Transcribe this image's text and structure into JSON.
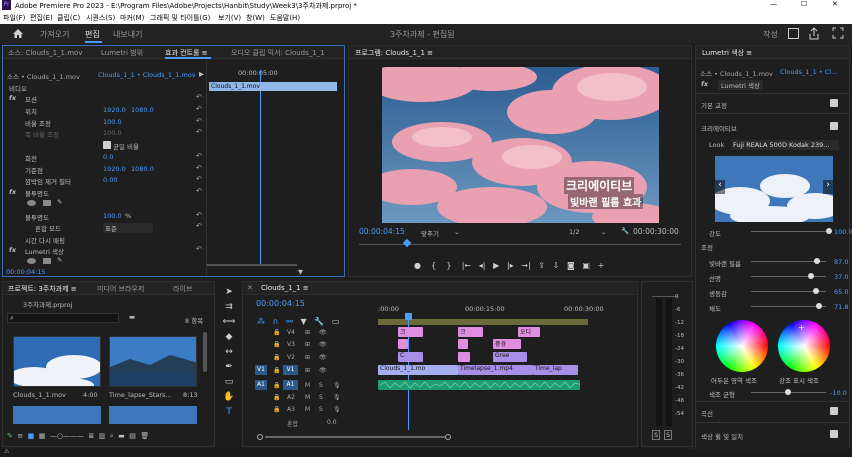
{
  "window": {
    "title": "Adobe Premiere Pro 2023 - E:\\Program Files\\Adobe\\Projects\\Hanbit\\Study\\Week3\\3주차과제.prproj *"
  },
  "menu": [
    "파일(F)",
    "편집(E)",
    "클립(C)",
    "시퀀스(S)",
    "마커(M)",
    "그래픽 및 타이틀(G)",
    "보기(V)",
    "창(W)",
    "도움말(H)"
  ],
  "workspace": {
    "tabs": [
      "가져오기",
      "편집",
      "내보내기"
    ],
    "active_tab": "편집",
    "doc_title": "3주차과제 - 편집됨",
    "right_label": "작성"
  },
  "effect_controls": {
    "tabs": [
      "소스: Clouds_1_1.mov",
      "Lumetri 범위",
      "효과 컨트롤 ≡",
      "오디오 클립 믹서: Clouds_1_1"
    ],
    "source_line": "소스 • Clouds_1_1.mov",
    "seq_line": "Clouds_1_1 • Clouds_1_1.mov",
    "time_label": "00:00:05:00",
    "clip_label": "Clouds_1_1.mov",
    "section_video": "비디오",
    "fx_motion": "모션",
    "position_label": "위치",
    "position_x": "1920.0",
    "position_y": "1080.0",
    "scale_label": "비율 조정",
    "scale_val": "100.0",
    "scale_width_label": "폭 비율 조정",
    "scale_width_val": "100.0",
    "uniform_scale": "균일 비율",
    "rotation_label": "회전",
    "rotation_val": "0.0",
    "anchor_label": "기준점",
    "anchor_x": "1920.0",
    "anchor_y": "1080.0",
    "antiflicker_label": "깜박임 제거 필터",
    "antiflicker_val": "0.00",
    "fx_opacity": "불투명도",
    "opacity_label": "불투명도",
    "opacity_val": "100.0",
    "opacity_unit": "%",
    "blend_label": "혼합 모드",
    "blend_val": "표준",
    "time_remap": "시간 다시 매핑",
    "fx_lumetri": "Lumetri 색상",
    "timecode": "00:00:04:15"
  },
  "program": {
    "tab": "프로그램: Clouds_1_1 ≡",
    "caption_line1": "크리에이티브",
    "caption_line2": "빛바랜 필름 효과",
    "timecode": "00:00:04:15",
    "fit": "맞추기",
    "resolution": "1/2",
    "duration": "00:00:30:00"
  },
  "project": {
    "tabs": [
      "프로젝트: 3주차과제 ≡",
      "미디어 브라우저",
      "라이브"
    ],
    "name": "3주차과제.prproj",
    "item_count": "8 항목",
    "items": [
      {
        "name": "Clouds_1_1.mov",
        "dur": "4:00"
      },
      {
        "name": "Time_lapse_Stars...",
        "dur": "8:13"
      }
    ]
  },
  "timeline": {
    "tab": "Clouds_1_1 ≡",
    "timecode": "00:00:04:15",
    "ruler": [
      ":00:00",
      "00:00:15:00",
      "00:00:30:00"
    ],
    "tracks": [
      "V4",
      "V3",
      "V2",
      "V1",
      "A1",
      "A2",
      "A3"
    ],
    "track_v1_label": "V1",
    "track_a1_label": "A1",
    "mix_label": "혼합",
    "mix_val": "0.0",
    "clips": {
      "v4_a": "크",
      "v4_b": "크",
      "v4_c": "오디",
      "v3_a": "풍경",
      "v2_a": "C",
      "v2_b": "Gree",
      "v1_a": "Clouds_1_1.mo",
      "v1_b": "Timelapse_1.mp4",
      "v1_c": "Time_lap"
    }
  },
  "meter": {
    "scale": [
      "0",
      "-6",
      "-12",
      "-18",
      "-24",
      "-30",
      "-36",
      "-42",
      "-48",
      "-54"
    ],
    "bottom": [
      "S",
      "S"
    ]
  },
  "lumetri": {
    "tab": "Lumetri 색상 ≡",
    "source_line": "소스 • Clouds_1_1.mov",
    "seq_line": "Clouds_1_1 • Cl...",
    "fx_label": "Lumetri 색상",
    "basic": "기본 교정",
    "creative": "크리에이티브",
    "look_label": "Look",
    "look_val": "Fuji REALA 500D Kodak 239...",
    "intensity_label": "강도",
    "intensity_val": "100.0",
    "adjust_label": "조정",
    "faded_label": "빛바랜 필름",
    "faded_val": "87.0",
    "sharpen_label": "선명",
    "sharpen_val": "37.0",
    "vibrance_label": "생동감",
    "vibrance_val": "65.0",
    "saturation_label": "채도",
    "saturation_val": "71.8",
    "shadow_tint": "어두운 영역 색조",
    "highlight_tint": "강조 표시 색조",
    "tint_balance_label": "색조 균형",
    "tint_balance_val": "-10.0",
    "curves": "곡선",
    "wheels": "색상 휠 및 일치"
  },
  "colors": {
    "accent": "#4b9cff",
    "clip_pink": "#e08ee0",
    "clip_purple": "#a98ee8",
    "clip_audio": "#1f9c72",
    "sky_pink": "#e69aa8",
    "sky_blue": "#3e6a9c"
  }
}
